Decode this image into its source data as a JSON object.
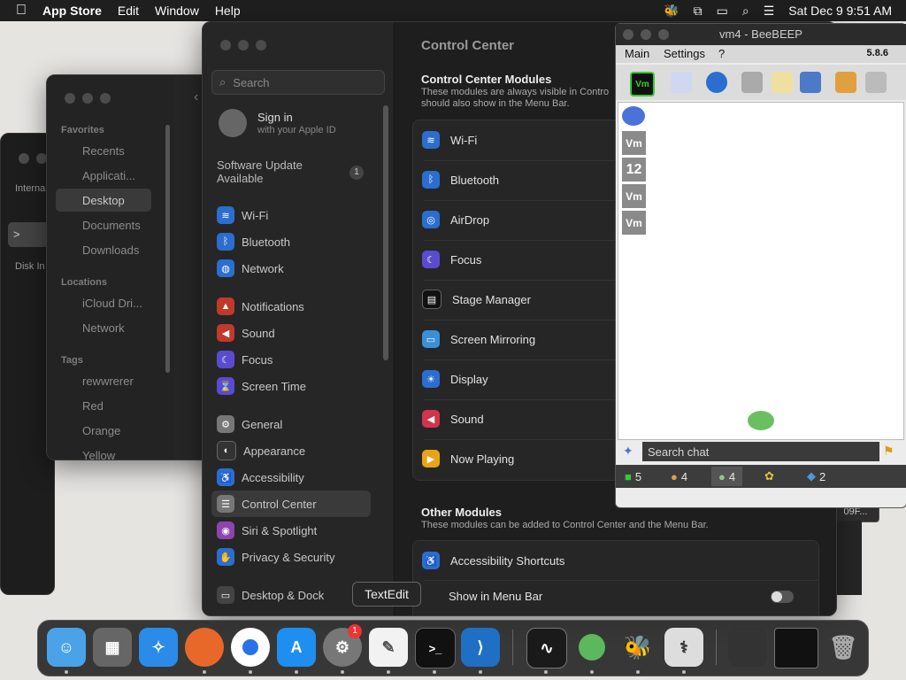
{
  "menubar": {
    "app_name": "App Store",
    "menus": [
      "Edit",
      "Window",
      "Help"
    ],
    "clock": "Sat Dec 9  9:51 AM"
  },
  "finder_back": {
    "labels": [
      "Interna",
      "Disk In"
    ]
  },
  "finder": {
    "favorites_header": "Favorites",
    "favorites": [
      "Recents",
      "Applicati...",
      "Desktop",
      "Documents",
      "Downloads"
    ],
    "locations_header": "Locations",
    "locations": [
      "iCloud Dri...",
      "Network"
    ],
    "tags_header": "Tags",
    "tags": [
      "rewwrerer",
      "Red",
      "Orange",
      "Yellow"
    ]
  },
  "settings": {
    "search_placeholder": "Search",
    "signin_title": "Sign in",
    "signin_sub": "with your Apple ID",
    "update_title": "Software Update Available",
    "update_badge": "1",
    "sidebar": [
      "Wi-Fi",
      "Bluetooth",
      "Network",
      "Notifications",
      "Sound",
      "Focus",
      "Screen Time",
      "General",
      "Appearance",
      "Accessibility",
      "Control Center",
      "Siri & Spotlight",
      "Privacy & Security",
      "Desktop & Dock"
    ],
    "page_title": "Control Center",
    "modules_title": "Control Center Modules",
    "modules_desc_1": "These modules are always visible in Contro",
    "modules_desc_2": "should also show in the Menu Bar.",
    "modules": [
      "Wi-Fi",
      "Bluetooth",
      "AirDrop",
      "Focus",
      "Stage Manager",
      "Screen Mirroring",
      "Display",
      "Sound",
      "Now Playing"
    ],
    "other_title": "Other Modules",
    "other_desc": "These modules can be added to Control Center and the Menu Bar.",
    "other_modules": [
      "Accessibility Shortcuts"
    ],
    "show_in_menubar": "Show in Menu Bar",
    "partial_text": "09F..."
  },
  "beebeep": {
    "title": "vm4 - BeeBEEP",
    "menu": [
      "Main",
      "Settings",
      "?"
    ],
    "version": "5.8.6",
    "users": [
      "Vm",
      "12",
      "Vm",
      "Vm"
    ],
    "search_placeholder": "Search chat",
    "tabs": [
      "5",
      "4",
      "4",
      "",
      "2"
    ]
  },
  "dock": {
    "tooltip": "TextEdit",
    "notification_badge": "1"
  },
  "colors": {
    "accent": "#0a84ff",
    "selection": "#3a3a3a"
  }
}
